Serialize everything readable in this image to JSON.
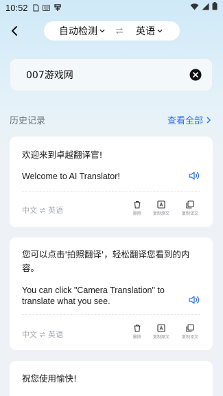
{
  "status_bar": {
    "time": "10:52"
  },
  "header": {
    "source_lang": "自动检测",
    "target_lang": "英语"
  },
  "input": {
    "value": "007游戏网"
  },
  "history": {
    "title": "历史记录",
    "view_all": "查看全部"
  },
  "cards": [
    {
      "source": "欢迎来到卓越翻译官!",
      "target": "Welcome to AI Translator!",
      "lang_from": "中文",
      "lang_to": "英语",
      "actions": [
        "删除",
        "复制原文",
        "复制译文"
      ]
    },
    {
      "source": "您可以点击'拍照翻译'，轻松翻译您看到的内容。",
      "target": "You can click \"Camera Translation\" to translate what you see.",
      "lang_from": "中文",
      "lang_to": "英语",
      "actions": [
        "删除",
        "复制原文",
        "复制译文"
      ]
    },
    {
      "source": "祝您使用愉快!"
    }
  ],
  "colors": {
    "accent": "#2f74e8",
    "muted": "#a7abb2"
  }
}
